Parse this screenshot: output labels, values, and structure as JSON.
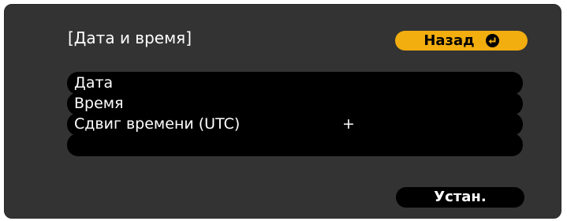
{
  "dialog": {
    "title": "[Дата и время]",
    "back_button_label": "Назад",
    "set_button_label": "Устан."
  },
  "menu": {
    "items": [
      {
        "label": "Дата",
        "value": ""
      },
      {
        "label": "Время",
        "value": ""
      },
      {
        "label": "Сдвиг времени (UTC)",
        "value": "+"
      },
      {
        "label": "",
        "value": ""
      }
    ]
  },
  "colors": {
    "background": "#333333",
    "accent": "#f2ad0f",
    "row": "#000000",
    "text": "#ffffff"
  },
  "icons": {
    "back": "enter-icon"
  }
}
